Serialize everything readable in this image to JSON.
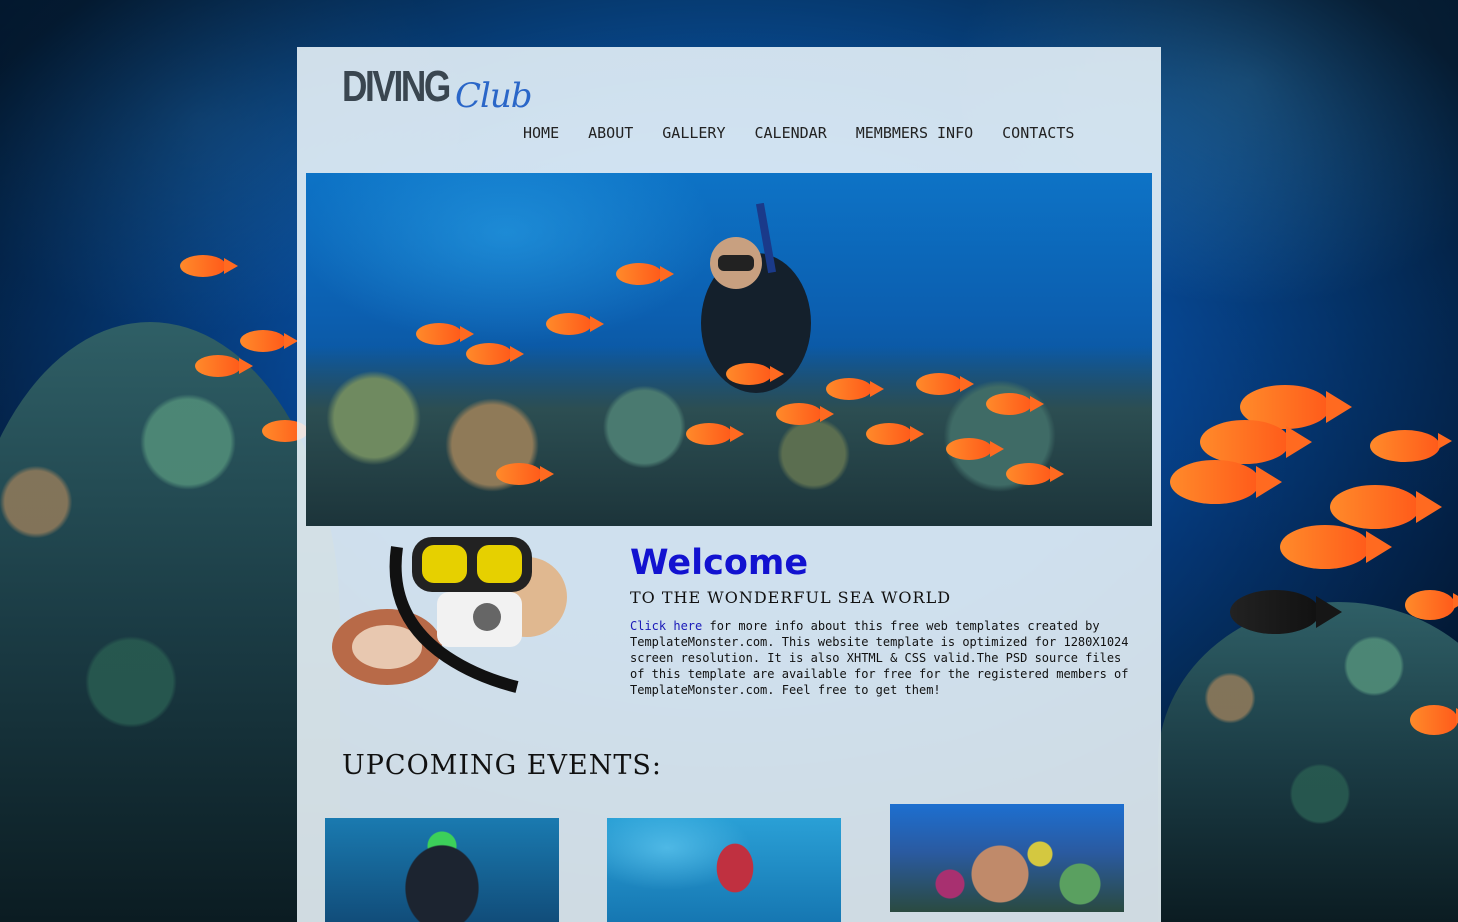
{
  "logo": {
    "main": "DIVING",
    "sub": "Club"
  },
  "nav": {
    "items": [
      {
        "label": "HOME"
      },
      {
        "label": "ABOUT"
      },
      {
        "label": "GALLERY"
      },
      {
        "label": "CALENDAR"
      },
      {
        "label": "MEMBMERS INFO"
      },
      {
        "label": "CONTACTS"
      }
    ]
  },
  "welcome": {
    "title": "Welcome",
    "subtitle": "TO THE WONDERFUL SEA WORLD",
    "link_text": "Click here",
    "body": " for more info about this free web templates created by TemplateMonster.com. This website template is optimized for 1280X1024 screen resolution. It is also XHTML & CSS valid.The PSD source files of this template are available for free for the registered members of TemplateMonster.com. Feel free to get them!"
  },
  "events": {
    "title": "UPCOMING EVENTS:"
  },
  "colors": {
    "accent": "#1212d0",
    "link": "#1a1ab8",
    "logo_blue": "#2a66c8",
    "panel_bg": "#ecf6fc"
  }
}
